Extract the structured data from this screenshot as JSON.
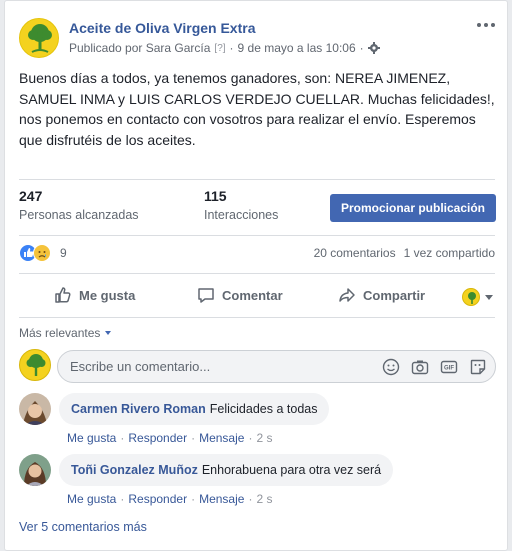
{
  "post": {
    "page_name": "Aceite de Oliva Virgen Extra",
    "published_by": "Publicado por Sara García",
    "help_mark": "[?]",
    "separator": "·",
    "date": "9 de mayo a las 10:06",
    "text": "Buenos días a todos, ya tenemos ganadores, son: NEREA JIMENEZ, SAMUEL INMA y LUIS CARLOS VERDEJO CUELLAR. Muchas felicidades!, nos ponemos en contacto con vosotros para realizar el envío. Esperemos que disfrutéis de los aceites."
  },
  "insights": {
    "reach_value": "247",
    "reach_label": "Personas alcanzadas",
    "interactions_value": "115",
    "interactions_label": "Interacciones",
    "promote_label": "Promocionar publicación"
  },
  "reactions": {
    "count": "9",
    "comments": "20 comentarios",
    "shares": "1 vez compartido",
    "icons": [
      "like-icon",
      "sad-icon"
    ]
  },
  "actions": {
    "like": "Me gusta",
    "comment": "Comentar",
    "share": "Compartir"
  },
  "comments_section": {
    "sort_label": "Más relevantes",
    "input_placeholder": "Escribe un comentario...",
    "input_icons": [
      "emoji-icon",
      "camera-icon",
      "gif-icon",
      "sticker-icon"
    ],
    "items": [
      {
        "author": "Carmen Rivero Roman",
        "text": "Felicidades a todas",
        "like": "Me gusta",
        "reply": "Responder",
        "message": "Mensaje",
        "time": "2 s"
      },
      {
        "author": "Toñi Gonzalez Muñoz",
        "text": "Enhorabuena para otra vez será",
        "like": "Me gusta",
        "reply": "Responder",
        "message": "Mensaje",
        "time": "2 s"
      }
    ],
    "more_label": "Ver 5 comentarios más"
  },
  "colors": {
    "link": "#365899",
    "promote_button": "#4267b2",
    "page_avatar": "#f4d21f"
  }
}
